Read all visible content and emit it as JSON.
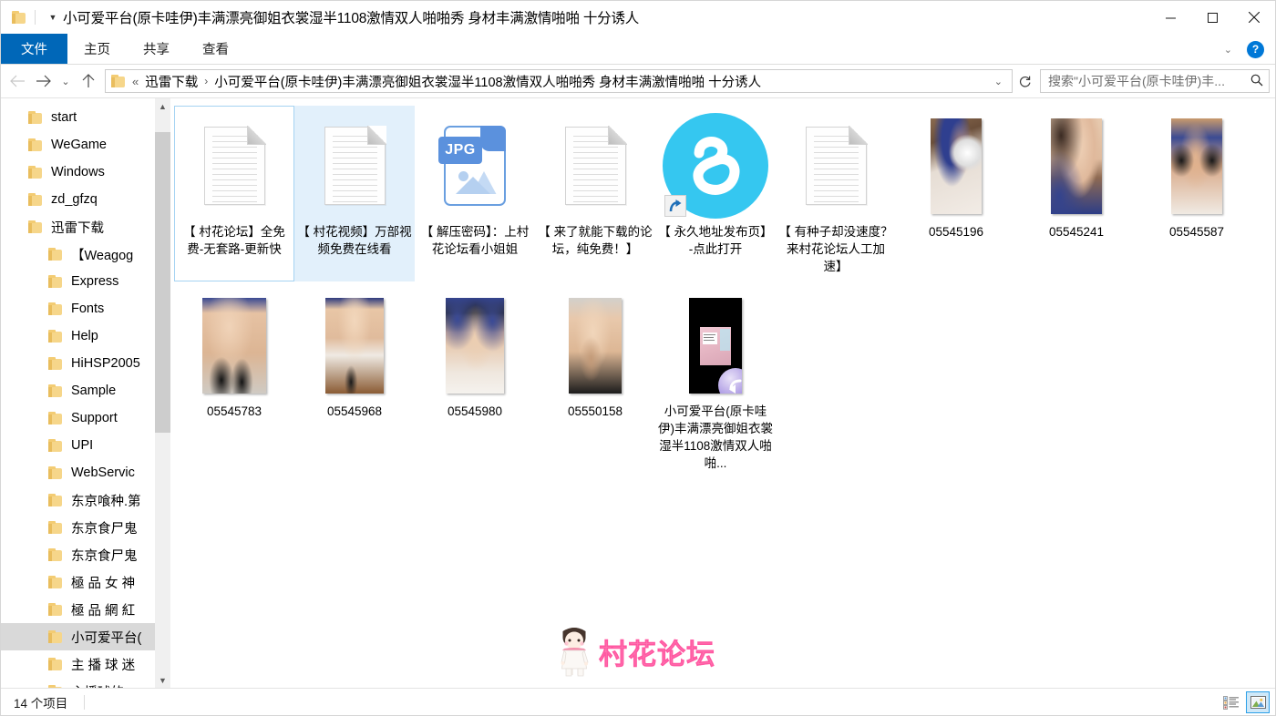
{
  "window": {
    "title": "小可爱平台(原卡哇伊)丰满漂亮御姐衣裳湿半1108激情双人啪啪秀 身材丰满激情啪啪 十分诱人",
    "minimize_label": "最小化",
    "maximize_label": "最大化",
    "close_label": "关闭"
  },
  "quick_access": {
    "folder_icon": "folder-icon",
    "dropdown_icon": "chevron-down-icon"
  },
  "ribbon": {
    "tabs": [
      {
        "label": "文件",
        "active": true
      },
      {
        "label": "主页",
        "active": false
      },
      {
        "label": "共享",
        "active": false
      },
      {
        "label": "查看",
        "active": false
      }
    ],
    "expand_icon": "chevron-down-icon",
    "help_label": "?"
  },
  "navigation": {
    "back_icon": "arrow-left-icon",
    "forward_icon": "arrow-right-icon",
    "recent_icon": "chevron-down-icon",
    "up_icon": "arrow-up-icon",
    "refresh_icon": "refresh-icon"
  },
  "address": {
    "folder_icon": "folder-icon",
    "lead": "«",
    "crumbs": [
      "迅雷下载",
      "小可爱平台(原卡哇伊)丰满漂亮御姐衣裳湿半1108激情双人啪啪秀 身材丰满激情啪啪 十分诱人"
    ],
    "separator": "›",
    "dropdown_icon": "chevron-down-icon"
  },
  "search": {
    "placeholder": "搜索\"小可爱平台(原卡哇伊)丰...",
    "icon": "search-icon"
  },
  "sidebar": {
    "items": [
      {
        "label": "start",
        "level": 1,
        "selected": false
      },
      {
        "label": "WeGame",
        "level": 1,
        "selected": false
      },
      {
        "label": "Windows",
        "level": 1,
        "selected": false
      },
      {
        "label": "zd_gfzq",
        "level": 1,
        "selected": false
      },
      {
        "label": "迅雷下载",
        "level": 1,
        "selected": false
      },
      {
        "label": "【Weagog",
        "level": 2,
        "selected": false
      },
      {
        "label": "Express",
        "level": 2,
        "selected": false
      },
      {
        "label": "Fonts",
        "level": 2,
        "selected": false
      },
      {
        "label": "Help",
        "level": 2,
        "selected": false
      },
      {
        "label": "HiHSP2005",
        "level": 2,
        "selected": false
      },
      {
        "label": "Sample",
        "level": 2,
        "selected": false
      },
      {
        "label": "Support",
        "level": 2,
        "selected": false
      },
      {
        "label": "UPI",
        "level": 2,
        "selected": false
      },
      {
        "label": "WebServic",
        "level": 2,
        "selected": false
      },
      {
        "label": "东京喰种.第",
        "level": 2,
        "selected": false
      },
      {
        "label": "东京食尸鬼",
        "level": 2,
        "selected": false
      },
      {
        "label": "东京食尸鬼",
        "level": 2,
        "selected": false
      },
      {
        "label": "極 品 女 神",
        "level": 2,
        "selected": false
      },
      {
        "label": "極 品 網 紅",
        "level": 2,
        "selected": false
      },
      {
        "label": "小可爱平台(",
        "level": 2,
        "selected": true
      },
      {
        "label": "主 播 球 迷",
        "level": 2,
        "selected": false
      },
      {
        "label": "主播球的",
        "level": 2,
        "selected": false
      }
    ],
    "scroll_up_icon": "chevron-up-icon",
    "scroll_down_icon": "chevron-down-icon"
  },
  "files": [
    {
      "name": "【 村花论坛】全免费-无套路-更新快",
      "icon": "document-icon",
      "state": "focused"
    },
    {
      "name": "【 村花视频】万部视频免费在线看",
      "icon": "document-icon",
      "state": "selected"
    },
    {
      "name": "【 解压密码】：上村花论坛看小姐姐",
      "icon": "jpg-image-icon",
      "badge": "JPG",
      "state": "normal"
    },
    {
      "name": "【 来了就能下载的论坛，纯免费！】",
      "icon": "document-icon",
      "state": "normal"
    },
    {
      "name": "【 永久地址发布页】-点此打开",
      "icon": "browser-shortcut-icon",
      "shortcut": true,
      "state": "normal"
    },
    {
      "name": "【 有种子却没速度？来村花论坛人工加速】",
      "icon": "document-icon",
      "state": "normal"
    },
    {
      "name": "05545196",
      "icon": "photo-thumbnail",
      "state": "normal"
    },
    {
      "name": "05545241",
      "icon": "photo-thumbnail",
      "state": "normal"
    },
    {
      "name": "05545587",
      "icon": "photo-thumbnail",
      "state": "normal"
    },
    {
      "name": "05545783",
      "icon": "photo-thumbnail",
      "state": "normal"
    },
    {
      "name": "05545968",
      "icon": "photo-thumbnail",
      "state": "normal"
    },
    {
      "name": "05545980",
      "icon": "photo-thumbnail",
      "state": "normal"
    },
    {
      "name": "05550158",
      "icon": "photo-thumbnail",
      "state": "normal"
    },
    {
      "name": "小可爱平台(原卡哇伊)丰满漂亮御姐衣裳湿半1108激情双人啪啪...",
      "icon": "video-shortcut-thumbnail",
      "shortcut": true,
      "state": "normal"
    }
  ],
  "watermark": {
    "text": "村花论坛",
    "color": "#ff6fae",
    "mascot": "girl-mascot-icon"
  },
  "status": {
    "item_count": "14 个项目",
    "view_details_icon": "details-view-icon",
    "view_large_icons_icon": "large-icons-view-icon",
    "active_view": "large-icons"
  },
  "colors": {
    "accent": "#0067b8",
    "selection": "#e2f0fb",
    "selection_border": "#a5d3f2",
    "tree_selection": "#d9d9d9",
    "e_icon": "#35c7f0",
    "jpg_blue": "#5b91dd"
  }
}
